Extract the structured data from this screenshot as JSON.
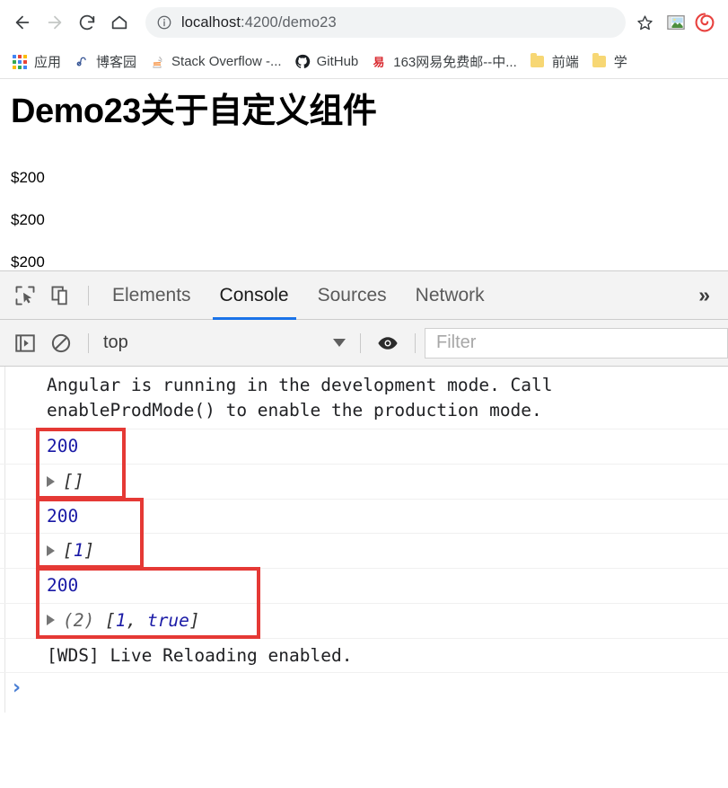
{
  "browser": {
    "nav": {
      "back_label": "Back",
      "forward_label": "Forward",
      "reload_label": "Reload",
      "home_label": "Home"
    },
    "omnibox": {
      "info_icon": "info-circle-icon",
      "host": "localhost",
      "path": ":4200/demo23",
      "full_url": "localhost:4200/demo23",
      "star_label": "Bookmark this tab"
    },
    "extensions": [
      {
        "name": "picture-extension-icon"
      },
      {
        "name": "spiral-extension-icon",
        "color": "#e8423f"
      }
    ],
    "bookmarks": [
      {
        "label": "应用",
        "icon": "apps-grid-icon"
      },
      {
        "label": "博客园",
        "icon": "cnblogs-icon"
      },
      {
        "label": "Stack Overflow -...",
        "icon": "stackoverflow-icon"
      },
      {
        "label": "GitHub",
        "icon": "github-icon"
      },
      {
        "label": "163网易免费邮--中...",
        "icon": "netease-icon"
      },
      {
        "label": "前端",
        "icon": "folder-icon"
      },
      {
        "label": "学",
        "icon": "folder-icon"
      }
    ]
  },
  "page": {
    "title": "Demo23关于自定义组件",
    "prices": [
      "$200",
      "$200",
      "$200"
    ]
  },
  "devtools": {
    "inspect_icon": "inspect-cursor-icon",
    "device_icon": "device-toolbar-icon",
    "tabs": [
      {
        "label": "Elements",
        "active": false
      },
      {
        "label": "Console",
        "active": true
      },
      {
        "label": "Sources",
        "active": false
      },
      {
        "label": "Network",
        "active": false
      }
    ],
    "more_tabs_label": "»",
    "console_toolbar": {
      "sidebar_icon": "console-sidebar-icon",
      "clear_icon": "clear-console-icon",
      "context": "top",
      "eye_icon": "live-expression-eye-icon",
      "filter_placeholder": "Filter",
      "filter_value": ""
    },
    "accent_color": "#1a73e8",
    "annotation_color": "#e53935",
    "messages": [
      {
        "type": "text",
        "text": "Angular is running in the development mode. Call enableProdMode() to enable the production mode."
      },
      {
        "type": "number",
        "text": "200"
      },
      {
        "type": "array",
        "prefix": "",
        "open": "[",
        "items": [],
        "close": "]"
      },
      {
        "type": "number",
        "text": "200"
      },
      {
        "type": "array",
        "prefix": "",
        "open": "[",
        "items": [
          "1"
        ],
        "close": "]"
      },
      {
        "type": "number",
        "text": "200"
      },
      {
        "type": "array",
        "prefix": "(2) ",
        "open": "[",
        "items": [
          "1",
          "true"
        ],
        "close": "]"
      },
      {
        "type": "text",
        "text": "[WDS] Live Reloading enabled."
      }
    ],
    "msg_200_a": "200",
    "msg_arr_a_prefix": "",
    "msg_arr_a_body": "[]",
    "msg_200_b": "200",
    "msg_arr_b_open": "[",
    "msg_arr_b_n": "1",
    "msg_arr_b_close": "]",
    "msg_200_c": "200",
    "msg_arr_c_len": "(2) ",
    "msg_arr_c_open": "[",
    "msg_arr_c_n": "1",
    "msg_arr_c_comma": ", ",
    "msg_arr_c_bool": "true",
    "msg_arr_c_close": "]",
    "msg_angular": "Angular is running in the development mode. Call enableProdMode() to enable the production mode.",
    "msg_wds": "[WDS] Live Reloading enabled.",
    "prompt_symbol": "›",
    "prompt_value": ""
  }
}
